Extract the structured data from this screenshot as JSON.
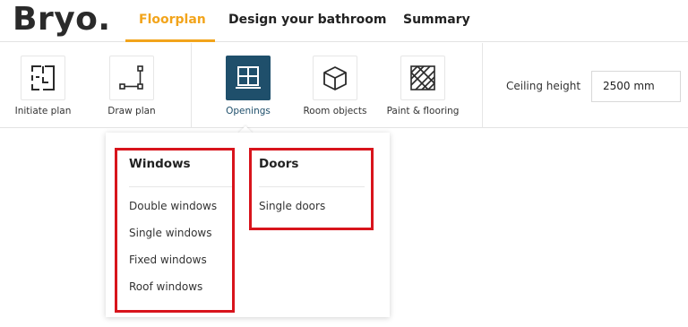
{
  "brand": {
    "logo": "Bryo."
  },
  "nav": {
    "tabs": [
      {
        "label": "Floorplan",
        "active": true
      },
      {
        "label": "Design your bathroom",
        "active": false
      },
      {
        "label": "Summary",
        "active": false
      }
    ],
    "accent": "#f2a41b"
  },
  "toolbar": {
    "tools": [
      {
        "label": "Initiate plan",
        "icon": "initiate-plan-icon"
      },
      {
        "label": "Draw plan",
        "icon": "draw-plan-icon"
      },
      {
        "label": "Openings",
        "icon": "window-icon",
        "active": true
      },
      {
        "label": "Room objects",
        "icon": "cube-icon"
      },
      {
        "label": "Paint & flooring",
        "icon": "flooring-icon"
      }
    ],
    "active_color": "#1f4f6b",
    "ceiling": {
      "label": "Ceiling height",
      "value": "2500 mm"
    }
  },
  "dropdown": {
    "windows": {
      "title": "Windows",
      "items": [
        "Double windows",
        "Single windows",
        "Fixed windows",
        "Roof windows"
      ]
    },
    "doors": {
      "title": "Doors",
      "items": [
        "Single doors"
      ]
    },
    "highlight_color": "#d8141c"
  }
}
